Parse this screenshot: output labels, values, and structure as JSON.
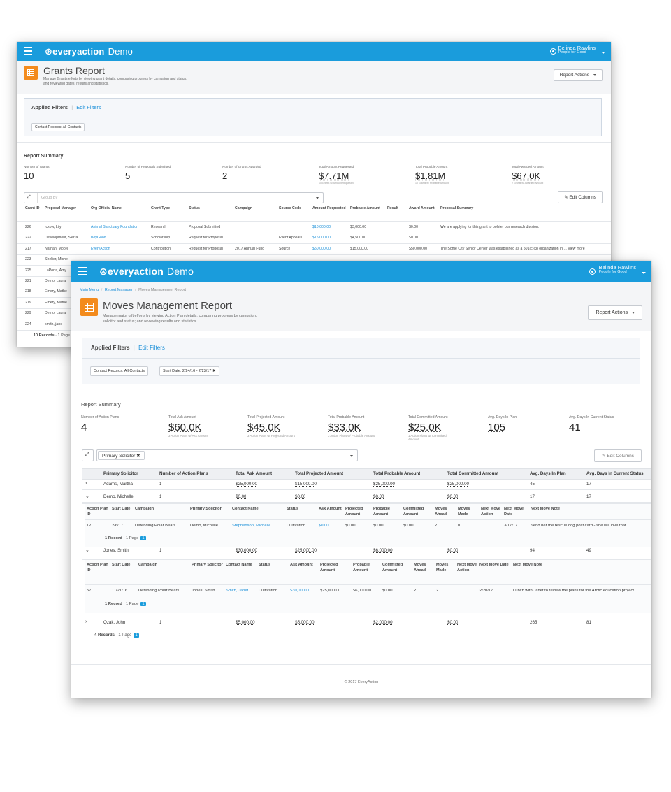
{
  "grants": {
    "topbar": {
      "brand": "everyaction",
      "demo": "Demo",
      "user_name": "Belinda Rawlins",
      "user_org": "People for Good"
    },
    "title": "Grants Report",
    "description_1": "Manage Grants efforts by viewing grant details; comparing progress by campaign and status;",
    "description_2": "and reviewing dates, results and statistics.",
    "report_actions": "Report Actions",
    "applied_filters": "Applied Filters",
    "edit_filters": "Edit Filters",
    "filter_chip": "Contact Records: All Contacts",
    "summary_title": "Report Summary",
    "summary": [
      {
        "label": "Number of Grants",
        "value": "10",
        "sub": ""
      },
      {
        "label": "Number of Proposals Submitted",
        "value": "5",
        "sub": ""
      },
      {
        "label": "Number of Grants Awarded",
        "value": "2",
        "sub": ""
      },
      {
        "label": "Total Amount Requested",
        "value": "$7.71M",
        "sub": "10 Grants w/ Amount Requested"
      },
      {
        "label": "Total Probable Amount",
        "value": "$1.81M",
        "sub": "10 Grants w/ Probable Amount"
      },
      {
        "label": "Total Awarded Amount",
        "value": "$67.0K",
        "sub": "2 Grants w/ Awarded Amount"
      }
    ],
    "group_by_placeholder": "Group By",
    "edit_columns": "Edit Columns",
    "columns": [
      "Grant ID",
      "Proposal Manager",
      "Org Official Name",
      "Grant Type",
      "Status",
      "Campaign",
      "Source Code",
      "Amount Requested",
      "Probable Amount",
      "Result",
      "Award Amount",
      "Proposal Summary"
    ],
    "rows": [
      [
        "226",
        "Ickow, Lily",
        "Animal Sanctuary Foundation",
        "Research",
        "Proposal Submitted",
        "",
        "",
        "$10,000.00",
        "$3,000.00",
        "",
        "$0.00",
        "We are applying for this grant to bolster our research division."
      ],
      [
        "222",
        "Development, Sierra",
        "BeyGood",
        "Scholarship",
        "Request for Proposal",
        "",
        "Event Appeals",
        "$15,000.00",
        "$4,500.00",
        "",
        "$0.00",
        ""
      ],
      [
        "217",
        "Nathan, Moore",
        "EveryAction",
        "Contribution",
        "Request for Proposal",
        "2017 Annual Fund",
        "Source",
        "$50,000.00",
        "$15,000.00",
        "",
        "$50,000.00",
        "The Some City Senior Center was established as a 501(c)(3) organization in ... View more"
      ],
      [
        "223",
        "Shelter, Michel",
        "",
        "",
        "",
        "",
        "",
        "",
        "",
        "",
        "",
        ""
      ],
      [
        "225",
        "LaPorta, Amy",
        "",
        "",
        "",
        "",
        "",
        "",
        "",
        "",
        "",
        ""
      ],
      [
        "221",
        "Demo, Laura",
        "",
        "",
        "",
        "",
        "",
        "",
        "",
        "",
        "",
        ""
      ],
      [
        "218",
        "Emery, Mathe",
        "",
        "",
        "",
        "",
        "",
        "",
        "",
        "",
        "",
        ""
      ],
      [
        "219",
        "Emery, Mathe",
        "",
        "",
        "",
        "",
        "",
        "",
        "",
        "",
        "",
        ""
      ],
      [
        "229",
        "Demo, Laura",
        "",
        "",
        "",
        "",
        "",
        "",
        "",
        "",
        "",
        ""
      ],
      [
        "224",
        "smith, jane",
        "",
        "",
        "",
        "",
        "",
        "",
        "",
        "",
        "",
        ""
      ]
    ],
    "records": "10 Records",
    "page_text": "1 Page"
  },
  "moves": {
    "topbar": {
      "brand": "everyaction",
      "demo": "Demo",
      "user_name": "Belinda Rawlins",
      "user_org": "People for Good"
    },
    "breadcrumb": [
      "Main Menu",
      "Report Manager",
      "Moves Management Report"
    ],
    "title": "Moves Management Report",
    "description_1": "Manage major gift efforts by viewing Action Plan details; comparing progress by campaign,",
    "description_2": "solicitor and status; and reviewing results and statistics.",
    "report_actions": "Report Actions",
    "applied_filters": "Applied Filters",
    "edit_filters": "Edit Filters",
    "filter_chips": [
      "Contact Records: All Contacts",
      "Start Date: 2/24/16 - 2/23/17"
    ],
    "summary_title": "Report Summary",
    "summary": [
      {
        "label": "Number of Action Plans",
        "value": "4",
        "sub": ""
      },
      {
        "label": "Total Ask Amount",
        "value": "$60.0K",
        "sub": "3 Action Plans w/ Ask Amount"
      },
      {
        "label": "Total Projected Amount",
        "value": "$45.0K",
        "sub": "3 Action Plans w/ Projected Amount"
      },
      {
        "label": "Total Probable Amount",
        "value": "$33.0K",
        "sub": "3 Action Plans w/ Probable Amount"
      },
      {
        "label": "Total Committed Amount",
        "value": "$25.0K",
        "sub": "1 Action Plans w/ Committed Amount"
      },
      {
        "label": "Avg. Days In Plan",
        "value": "105",
        "sub": ""
      },
      {
        "label": "Avg. Days In Current Status",
        "value": "41",
        "sub": ""
      }
    ],
    "group_chip": "Primary Solicitor",
    "edit_columns": "Edit Columns",
    "columns": [
      "Primary Solicitor",
      "Number of Action Plans",
      "Total Ask Amount",
      "Total Projected Amount",
      "Total Probable Amount",
      "Total Committed Amount",
      "Avg. Days In Plan",
      "Avg. Days In Current Status"
    ],
    "groups": [
      {
        "name": "Adams, Martha",
        "plans": "1",
        "ask": "$25,000.00",
        "projected": "$15,000.00",
        "probable": "$25,000.00",
        "committed": "$25,000.00",
        "days_plan": "45",
        "days_status": "17"
      },
      {
        "name": "Demo, Michelle",
        "plans": "1",
        "ask": "$0.00",
        "projected": "$0.00",
        "probable": "$0.00",
        "committed": "$0.00",
        "days_plan": "17",
        "days_status": "17"
      },
      {
        "name": "Jones, Smith",
        "plans": "1",
        "ask": "$30,000.00",
        "projected": "$25,000.00",
        "probable": "$6,000.00",
        "committed": "$0.00",
        "days_plan": "94",
        "days_status": "49"
      },
      {
        "name": "Qzak, John",
        "plans": "1",
        "ask": "$5,000.00",
        "projected": "$5,000.00",
        "probable": "$2,000.00",
        "committed": "$0.00",
        "days_plan": "265",
        "days_status": "81"
      }
    ],
    "detail_columns": [
      "Action Plan ID",
      "Start Date",
      "Campaign",
      "Primary Solicitor",
      "Contact Name",
      "Status",
      "Ask Amount",
      "Projected Amount",
      "Probable Amount",
      "Committed Amount",
      "Moves Ahead",
      "Moves Made",
      "Next Move Action",
      "Next Move Date",
      "Next Move Note"
    ],
    "detail1": [
      "12",
      "2/6/17",
      "Defending Polar Bears",
      "Demo, Michelle",
      "Stephenson, Michelle",
      "Cultivation",
      "$0.00",
      "$0.00",
      "$0.00",
      "$0.00",
      "2",
      "0",
      "",
      "3/17/17",
      "Send her the rescue dog post card - she will love that."
    ],
    "detail2": [
      "57",
      "11/21/16",
      "Defending Polar Bears",
      "Jones, Smith",
      "Smith, Janet",
      "Cultivation",
      "$30,000.00",
      "$25,000.00",
      "$6,000.00",
      "$0.00",
      "2",
      "2",
      "",
      "2/20/17",
      "Lunch with Janet to review the plans for the Arctic education project."
    ],
    "detail_records": "1 Record",
    "page_text": "1 Page",
    "page_num": "1",
    "records": "4 Records",
    "footer": "© 2017 EveryAction"
  },
  "colors": {
    "topbar": "#1a9cdc",
    "accent": "#f38b1d",
    "link": "#1a8fd8"
  }
}
